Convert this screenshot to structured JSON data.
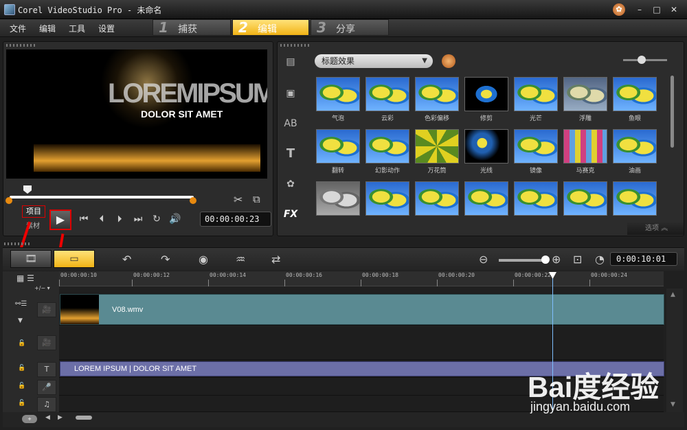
{
  "window": {
    "title": "Corel VideoStudio Pro - 未命名",
    "minimize": "–",
    "maximize": "□",
    "close": "✕",
    "help": "✿"
  },
  "menu": [
    "文件",
    "编辑",
    "工具",
    "设置"
  ],
  "steps": [
    {
      "num": "1",
      "label": "捕获"
    },
    {
      "num": "2",
      "label": "编辑"
    },
    {
      "num": "3",
      "label": "分享"
    }
  ],
  "preview": {
    "video_title": "LOREMIPSUM",
    "video_subtitle": "DOLOR SIT AMET",
    "mode_project": "项目",
    "mode_clip": "素材",
    "timecode": "00:00:00:23",
    "scrub_position": 0.1
  },
  "library": {
    "category": "标题效果",
    "items": [
      "气泡",
      "云彩",
      "色彩偏移",
      "修剪",
      "光芒",
      "浮雕",
      "鱼眼",
      "翻转",
      "幻影动作",
      "万花筒",
      "光线",
      "镜像",
      "马赛克",
      "油画"
    ],
    "options_label": "选项"
  },
  "timeline": {
    "duration": "0:00:10:01",
    "ruler_ticks": [
      "00:00:00:10",
      "00:00:00:12",
      "00:00:00:14",
      "00:00:00:16",
      "00:00:00:18",
      "00:00:00:20",
      "00:00:00:22",
      "00:00:00:24"
    ],
    "video_clip": "V08.wmv",
    "title_clip": "LOREM IPSUM | DOLOR SIT AMET"
  },
  "watermark": {
    "logo": "Bai度经验",
    "url": "jingyan.baidu.com"
  },
  "colors": {
    "accent": "#f1b316",
    "highlight_box": "#dd0000",
    "video_track": "#5a8a92",
    "title_track": "#6c6fa7"
  }
}
